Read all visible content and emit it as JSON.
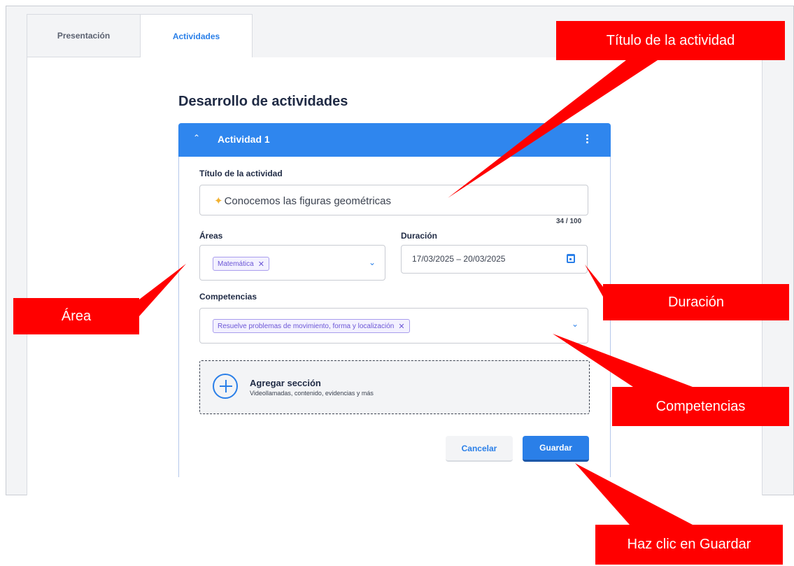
{
  "tabs": [
    {
      "label": "Presentación",
      "active": false
    },
    {
      "label": "Actividades",
      "active": true
    }
  ],
  "main": {
    "section_title": "Desarrollo de actividades",
    "activity": {
      "title": "Actividad 1",
      "fields": {
        "titulo_label": "Título de la actividad",
        "titulo_value": "Conocemos las figuras geométricas",
        "char_count": "34 / 100",
        "areas_label": "Áreas",
        "areas_chip": "Matemática",
        "duracion_label": "Duración",
        "duracion_value": "17/03/2025 – 20/03/2025",
        "competencias_label": "Competencias",
        "competencias_chip": "Resuelve problemas de movimiento, forma y localización"
      },
      "add_section": {
        "title": "Agregar sección",
        "subtitle": "Videollamadas, contenido, evidencias y más"
      },
      "buttons": {
        "cancel": "Cancelar",
        "save": "Guardar"
      }
    }
  },
  "callouts": {
    "titulo": "Título de la actividad",
    "area": "Área",
    "duracion": "Duración",
    "competencias": "Competencias",
    "guardar": "Haz clic en Guardar"
  },
  "colors": {
    "primary": "#2a7fe8",
    "callout": "#ff0000",
    "chip_text": "#6b55d6"
  },
  "icons": [
    "chevron-up-icon",
    "kebab-menu-icon",
    "sparkle-icon",
    "chevron-down-icon",
    "calendar-icon",
    "close-icon",
    "plus-circle-icon"
  ]
}
